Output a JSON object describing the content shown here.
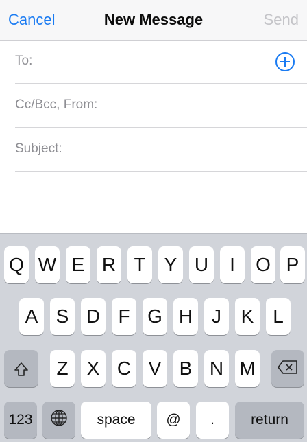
{
  "nav": {
    "cancel": "Cancel",
    "title": "New Message",
    "send": "Send"
  },
  "fields": {
    "to": "To:",
    "cc": "Cc/Bcc, From:",
    "subject": "Subject:"
  },
  "keyboard": {
    "row1": [
      "Q",
      "W",
      "E",
      "R",
      "T",
      "Y",
      "U",
      "I",
      "O",
      "P"
    ],
    "row2": [
      "A",
      "S",
      "D",
      "F",
      "G",
      "H",
      "J",
      "K",
      "L"
    ],
    "row3": [
      "Z",
      "X",
      "C",
      "V",
      "B",
      "N",
      "M"
    ],
    "numbers": "123",
    "space": "space",
    "at": "@",
    "period": ".",
    "return": "return"
  },
  "colors": {
    "accent": "#1a7bf2",
    "disabled": "#c4c4c8",
    "keyboard_bg": "#d1d4da"
  }
}
